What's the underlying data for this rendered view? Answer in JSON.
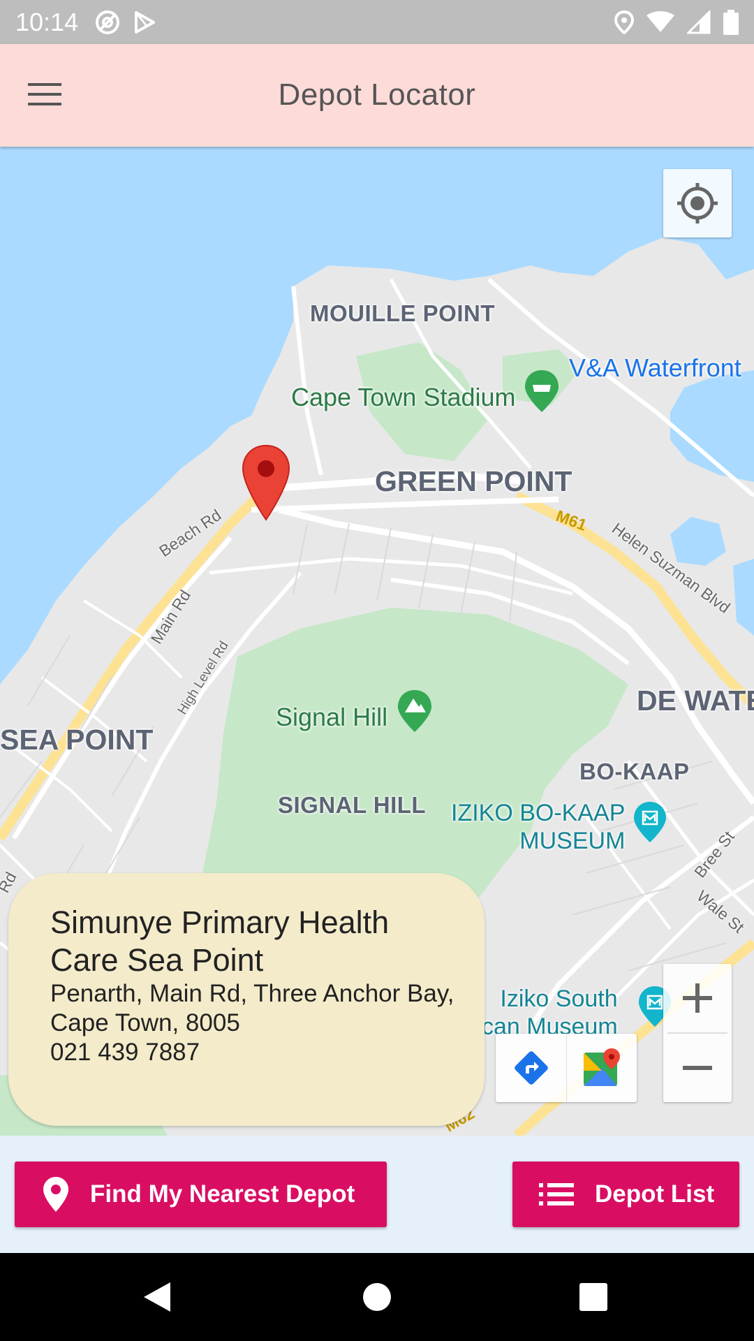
{
  "status_bar": {
    "time": "10:14",
    "left_icons": [
      "at-sign-icon",
      "play-store-icon"
    ],
    "right_icons": [
      "location-icon",
      "wifi-icon",
      "signal-icon",
      "battery-icon"
    ]
  },
  "app_bar": {
    "title": "Depot Locator",
    "menu_icon": "hamburger-menu-icon"
  },
  "map": {
    "labels": {
      "mouille_point": "MOUILLE POINT",
      "cape_town_stadium": "Cape Town Stadium",
      "va_waterfront": "V&A Waterfront",
      "green_point": "GREEN POINT",
      "beach_rd": "Beach Rd",
      "m61": "M61",
      "helen_suzman": "Helen Suzman Blvd",
      "main_rd": "Main Rd",
      "high_level_rd": "High Level Rd",
      "signal_hill_poi": "Signal Hill",
      "de_waterkant": "DE WATE",
      "sea_point": "SEA POINT",
      "bo_kaap": "BO-KAAP",
      "signal_hill_area": "SIGNAL HILL",
      "iziko_bokaap": "IZIKO BO-KAAP\nMUSEUM",
      "bree_st": "Bree St",
      "wale_st": "Wale St",
      "iziko_south": "Iziko South\ncan Museum",
      "rd_left": "Rd",
      "m62": "M62"
    },
    "colors": {
      "water": "#aadaff",
      "land": "#e8e8e8",
      "park": "#c6e7c8",
      "road": "#ffffff",
      "highway": "#fde293",
      "pin": "#ea4335"
    }
  },
  "info_card": {
    "name": "Simunye Primary Health Care Sea Point",
    "address": "Penarth, Main Rd, Three Anchor Bay, Cape Town, 8005",
    "phone": "021 439 7887"
  },
  "buttons": {
    "nearest_label": "Find My Nearest Depot",
    "list_label": "Depot List",
    "color": "#d90e63"
  },
  "nav_bar": {
    "back_icon": "back-triangle-icon",
    "home_icon": "home-circle-icon",
    "recents_icon": "recents-square-icon"
  }
}
